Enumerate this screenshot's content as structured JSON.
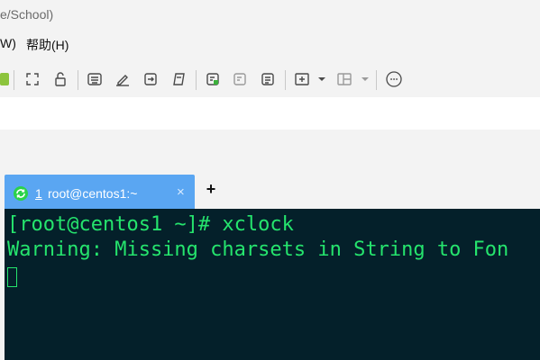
{
  "window": {
    "title": "e/School)"
  },
  "menu": {
    "items": [
      {
        "label": "W)"
      },
      {
        "label": "帮助(H)"
      }
    ]
  },
  "toolbar": {
    "icons": [
      "green-tab-icon",
      "fullscreen-icon",
      "lock-icon",
      "keyboard-icon",
      "highlight-pen-icon",
      "send-to-icon",
      "script-icon",
      "new-session-icon",
      "session-manager-icon",
      "notes-icon",
      "new-window-icon",
      "dropdown-icon",
      "layout-icon",
      "dropdown-icon",
      "chat-icon"
    ]
  },
  "tabs": [
    {
      "number": "1",
      "label": "root@centos1:~",
      "close": "×",
      "active": true
    }
  ],
  "add_tab_label": "+",
  "terminal": {
    "lines": [
      "[root@centos1 ~]# xclock",
      "Warning: Missing charsets in String to Fon"
    ],
    "text_color": "#25e46d",
    "background": "#04202a"
  },
  "colors": {
    "tab_accent": "#5aa6f2"
  }
}
